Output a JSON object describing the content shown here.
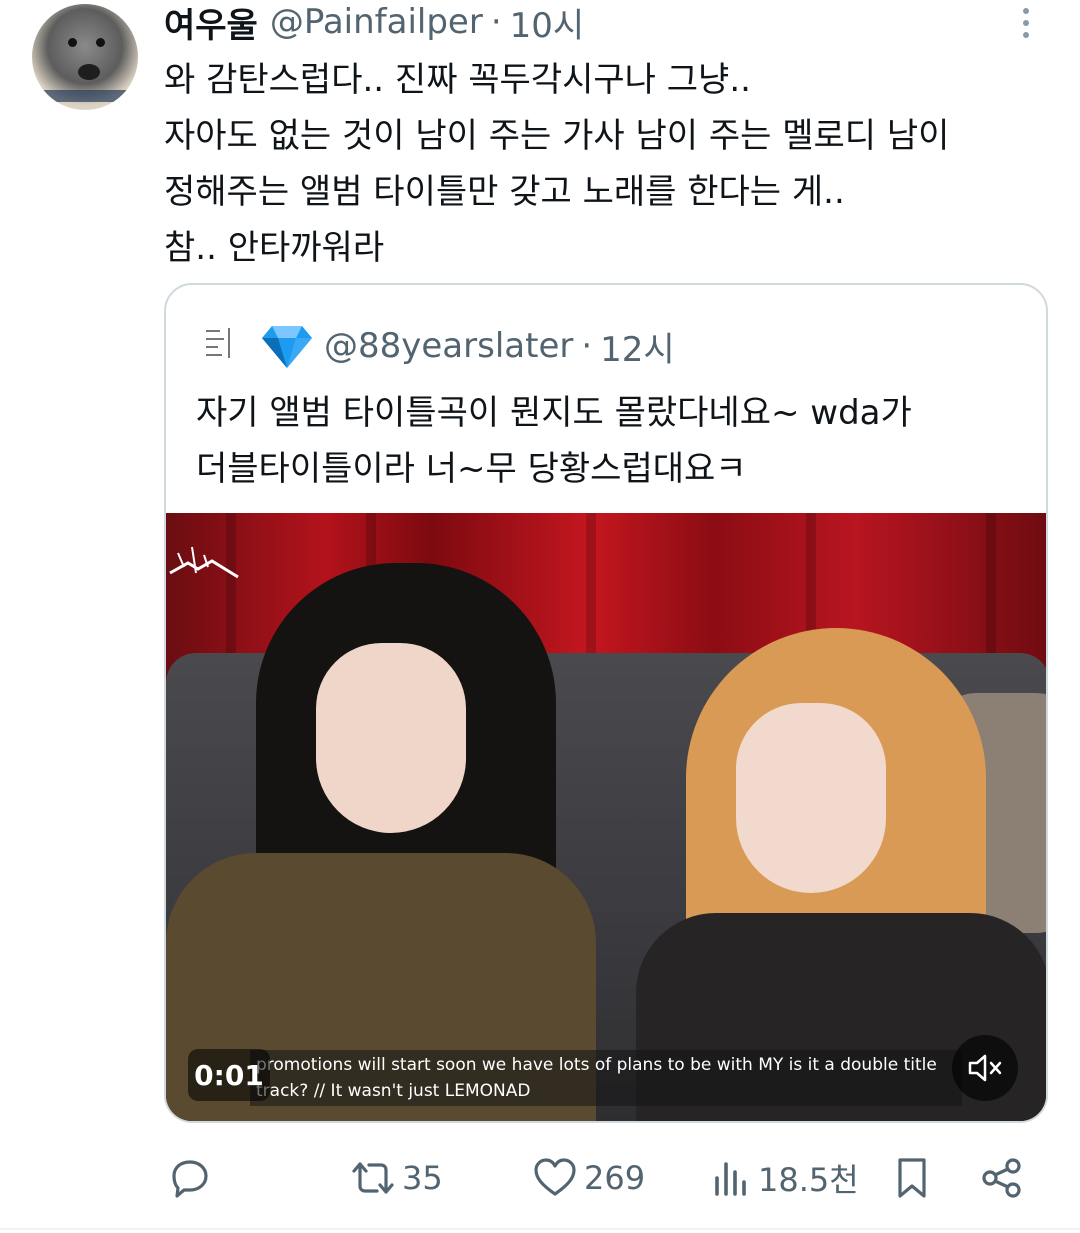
{
  "tweet": {
    "display_name": "여우울",
    "handle": "@Painfailper",
    "separator": "·",
    "time": "10시",
    "lines": [
      "와 감탄스럽다.. 진짜 꼭두각시구나 그냥..",
      "자아도 없는 것이 남이 주는 가사 남이 주는 멜로디 남이",
      "정해주는 앨범 타이틀만 갖고 노래를 한다는 게..",
      "참.. 안타까워라"
    ]
  },
  "quote": {
    "handle": "@88yearslater",
    "separator": "·",
    "time": "12시",
    "badge_icon": "gem-icon",
    "lines": [
      "자기 앨범 타이틀곡이 뭔지도 몰랐다네요~ wda가",
      "더블타이틀이라 너~무 당황스럽대요ㅋ"
    ],
    "video": {
      "timestamp": "0:01",
      "subtitle_lines": [
        "promotions will start soon we have lots of plans to be with MY is it a double title",
        "track? // It wasn't just LEMONAD"
      ],
      "mute_icon": "speaker-muted-icon"
    }
  },
  "actions": {
    "reply_icon": "reply-icon",
    "retweet_icon": "retweet-icon",
    "retweets": "35",
    "like_icon": "heart-icon",
    "likes": "269",
    "views_icon": "views-icon",
    "views": "18.5천",
    "bookmark_icon": "bookmark-icon",
    "share_icon": "share-icon"
  },
  "colors": {
    "text": "#0f1419",
    "secondary": "#536471",
    "border": "#cfd9de",
    "gem": "#1d9bf0"
  }
}
